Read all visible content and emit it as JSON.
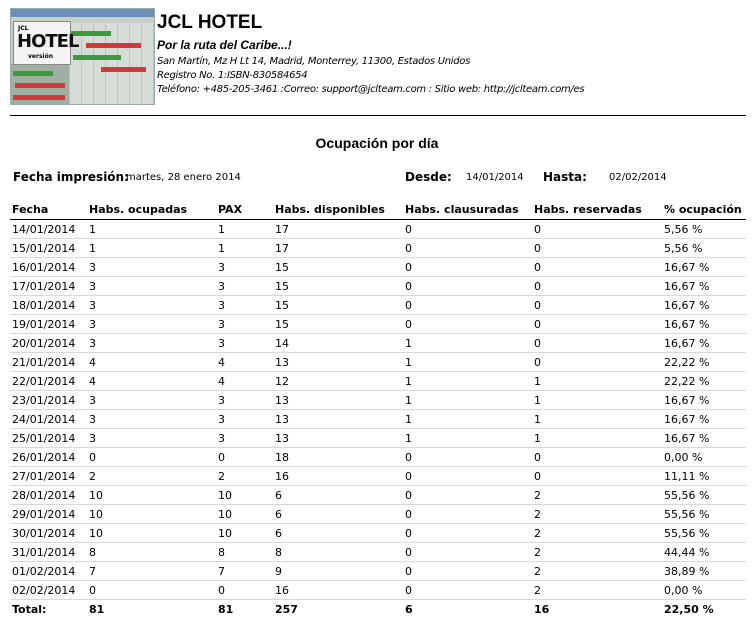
{
  "header": {
    "logo_small": "JCL",
    "logo_big": "HOTEL",
    "logo_version": "versión",
    "hotel_name": "JCL HOTEL",
    "tagline": "Por la ruta del Caribe...!",
    "address": "San Martín, Mz H Lt 14, Madrid, Monterrey, 11300, Estados Unidos",
    "registry": "Registro No. 1:ISBN-830584654",
    "contact": "Teléfono: +485-205-3461 :Correo: support@jclteam.com : Sitio web: http://jclteam.com/es"
  },
  "report": {
    "title": "Ocupación por día",
    "print_date_label": "Fecha impresión:",
    "print_date_value": "martes, 28 enero 2014",
    "from_label": "Desde:",
    "from_value": "14/01/2014",
    "to_label": "Hasta:",
    "to_value": "02/02/2014"
  },
  "table": {
    "columns": [
      "Fecha",
      "Habs. ocupadas",
      "PAX",
      "Habs. disponibles",
      "Habs. clausuradas",
      "Habs. reservadas",
      "% ocupación"
    ],
    "rows": [
      [
        "14/01/2014",
        "1",
        "1",
        "17",
        "0",
        "0",
        "5,56 %"
      ],
      [
        "15/01/2014",
        "1",
        "1",
        "17",
        "0",
        "0",
        "5,56 %"
      ],
      [
        "16/01/2014",
        "3",
        "3",
        "15",
        "0",
        "0",
        "16,67 %"
      ],
      [
        "17/01/2014",
        "3",
        "3",
        "15",
        "0",
        "0",
        "16,67 %"
      ],
      [
        "18/01/2014",
        "3",
        "3",
        "15",
        "0",
        "0",
        "16,67 %"
      ],
      [
        "19/01/2014",
        "3",
        "3",
        "15",
        "0",
        "0",
        "16,67 %"
      ],
      [
        "20/01/2014",
        "3",
        "3",
        "14",
        "1",
        "0",
        "16,67 %"
      ],
      [
        "21/01/2014",
        "4",
        "4",
        "13",
        "1",
        "0",
        "22,22 %"
      ],
      [
        "22/01/2014",
        "4",
        "4",
        "12",
        "1",
        "1",
        "22,22 %"
      ],
      [
        "23/01/2014",
        "3",
        "3",
        "13",
        "1",
        "1",
        "16,67 %"
      ],
      [
        "24/01/2014",
        "3",
        "3",
        "13",
        "1",
        "1",
        "16,67 %"
      ],
      [
        "25/01/2014",
        "3",
        "3",
        "13",
        "1",
        "1",
        "16,67 %"
      ],
      [
        "26/01/2014",
        "0",
        "0",
        "18",
        "0",
        "0",
        "0,00 %"
      ],
      [
        "27/01/2014",
        "2",
        "2",
        "16",
        "0",
        "0",
        "11,11 %"
      ],
      [
        "28/01/2014",
        "10",
        "10",
        "6",
        "0",
        "2",
        "55,56 %"
      ],
      [
        "29/01/2014",
        "10",
        "10",
        "6",
        "0",
        "2",
        "55,56 %"
      ],
      [
        "30/01/2014",
        "10",
        "10",
        "6",
        "0",
        "2",
        "55,56 %"
      ],
      [
        "31/01/2014",
        "8",
        "8",
        "8",
        "0",
        "2",
        "44,44 %"
      ],
      [
        "01/02/2014",
        "7",
        "7",
        "9",
        "0",
        "2",
        "38,89 %"
      ],
      [
        "02/02/2014",
        "0",
        "0",
        "16",
        "0",
        "2",
        "0,00 %"
      ]
    ],
    "total": [
      "Total:",
      "81",
      "81",
      "257",
      "6",
      "16",
      "22,50 %"
    ]
  }
}
